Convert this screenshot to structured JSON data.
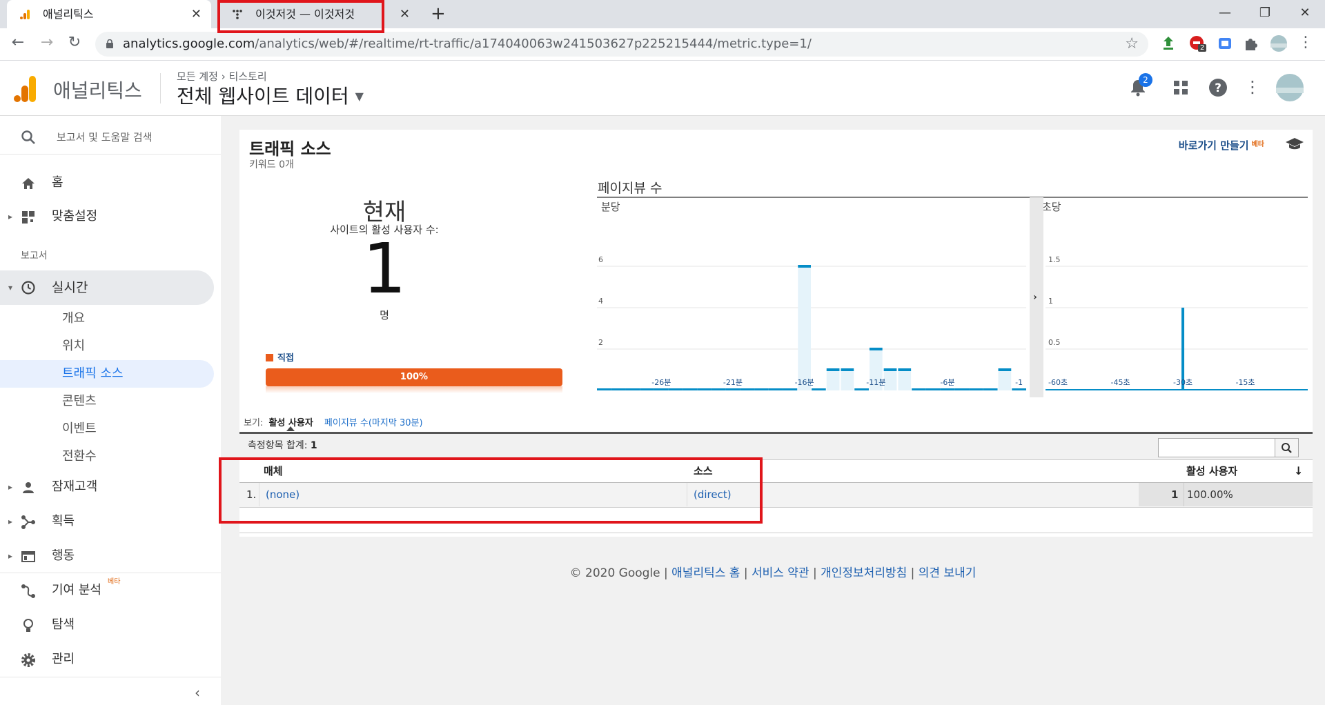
{
  "browser": {
    "tabs": [
      {
        "title": "애널리틱스"
      },
      {
        "title": "이것저것 — 이것저것"
      }
    ],
    "url_host": "analytics.google.com",
    "url_path": "/analytics/web/#/realtime/rt-traffic/a174040063w241503627p225215444/metric.type=1/",
    "ext_badge": "2"
  },
  "header": {
    "app_title": "애널리틱스",
    "breadcrumb_account": "모든 계정",
    "breadcrumb_property": "티스토리",
    "view_name": "전체 웹사이트 데이터",
    "notification_count": "2"
  },
  "sidebar": {
    "search_label": "보고서 및 도움말 검색",
    "home": "홈",
    "custom": "맞춤설정",
    "section_reports": "보고서",
    "realtime": "실시간",
    "realtime_sub": [
      "개요",
      "위치",
      "트래픽 소스",
      "콘텐츠",
      "이벤트",
      "전환수"
    ],
    "audience": "잠재고객",
    "acquisition": "획득",
    "behavior": "행동",
    "attribution": "기여 분석",
    "attribution_badge": "베타",
    "discover": "탐색",
    "admin": "관리"
  },
  "page": {
    "title": "트래픽 소스",
    "subtitle": "키워드 0개",
    "shortcut": "바로가기 만들기",
    "shortcut_badge": "베타",
    "now_label": "현재",
    "active_users_label": "사이트의 활성 사용자 수:",
    "active_users": "1",
    "unit": "명",
    "legend_direct": "직접",
    "progress_label": "100%",
    "pageviews_title": "페이지뷰 수",
    "view_label": "보기:",
    "view_active": "활성 사용자",
    "view_pageviews": "페이지뷰 수(마지막 30분)",
    "summary_label": "측정항목 합계:",
    "summary_value": "1",
    "table": {
      "headers": [
        "매체",
        "소스",
        "활성 사용자"
      ],
      "rows": [
        {
          "index": "1.",
          "medium": "(none)",
          "source": "(direct)",
          "users": "1",
          "pct": "100.00%"
        }
      ]
    }
  },
  "footer": {
    "copyright": "© 2020 Google",
    "links": [
      "애널리틱스 홈",
      "서비스 약관",
      "개인정보처리방침",
      "의견 보내기"
    ]
  },
  "chart_data": [
    {
      "type": "bar",
      "title": "분당",
      "x_tick_labels": [
        "-26분",
        "-21분",
        "-16분",
        "-11분",
        "-6분",
        "-1"
      ],
      "y_ticks": [
        2,
        4,
        6
      ],
      "ylim": [
        0,
        8
      ],
      "x": [
        -30,
        -29,
        -28,
        -27,
        -26,
        -25,
        -24,
        -23,
        -22,
        -21,
        -20,
        -19,
        -18,
        -17,
        -16,
        -15,
        -14,
        -13,
        -12,
        -11,
        -10,
        -9,
        -8,
        -7,
        -6,
        -5,
        -4,
        -3,
        -2,
        -1
      ],
      "values": [
        0,
        0,
        0,
        0,
        0,
        0,
        0,
        0,
        0,
        0,
        0,
        0,
        0,
        0,
        6,
        0,
        1,
        1,
        0,
        2,
        1,
        1,
        0,
        0,
        0,
        0,
        0,
        0,
        1,
        0
      ],
      "bar_color": "#058dc7",
      "fill_color": "#e5f3fa"
    },
    {
      "type": "bar",
      "title": "초당",
      "x_tick_labels": [
        "-60초",
        "-45초",
        "-30초",
        "-15초"
      ],
      "y_ticks": [
        0.5,
        1,
        1.5
      ],
      "ylim": [
        0,
        2
      ],
      "x": [
        -30
      ],
      "values": [
        1
      ],
      "bar_color": "#058dc7"
    }
  ]
}
